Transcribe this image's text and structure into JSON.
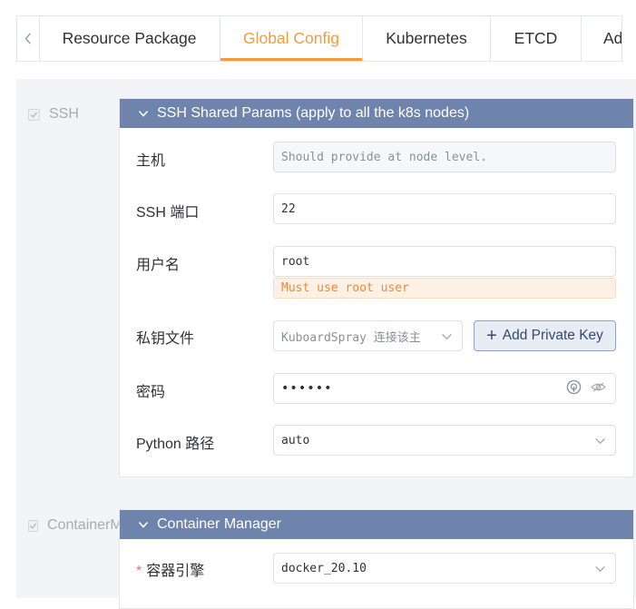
{
  "tabs": {
    "back_icon": "chevron-left-icon",
    "items": [
      {
        "label": "Resource Package"
      },
      {
        "label": "Global Config"
      },
      {
        "label": "Kubernetes"
      },
      {
        "label": "ETCD"
      },
      {
        "label": "Ad"
      }
    ],
    "active_index": 1,
    "active_color": "#f39c3c"
  },
  "ssh_section": {
    "check_label": "SSH",
    "panel_title": "SSH Shared Params (apply to all the k8s nodes)",
    "header_color": "#6f84ad",
    "host": {
      "label": "主机",
      "placeholder": "Should provide at node level."
    },
    "port": {
      "label": "SSH 端口",
      "value": "22"
    },
    "user": {
      "label": "用户名",
      "value": "root",
      "warning": "Must use root user"
    },
    "key": {
      "label": "私钥文件",
      "select_value": "KuboardSpray 连接该主",
      "add_button": "Add Private Key"
    },
    "password": {
      "label": "密码",
      "value": "••••••"
    },
    "python": {
      "label": "Python 路径",
      "value": "auto"
    }
  },
  "container_section": {
    "check_label": "ContainerM",
    "panel_title": "Container Manager",
    "engine": {
      "required_mark": "*",
      "label": "容器引擎",
      "value": "docker_20.10"
    }
  }
}
